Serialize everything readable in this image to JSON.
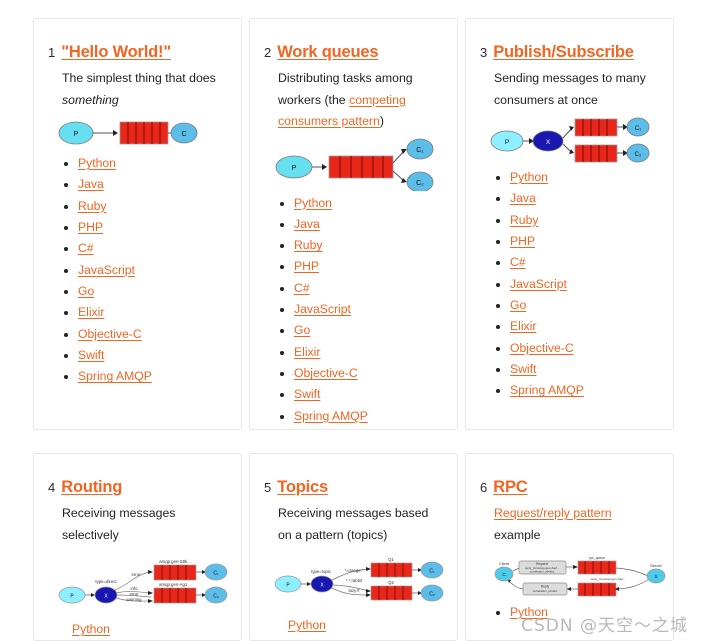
{
  "page": {
    "watermark": "CSDN @天空～之城"
  },
  "languages": [
    "Python",
    "Java",
    "Ruby",
    "PHP",
    "C#",
    "JavaScript",
    "Go",
    "Elixir",
    "Objective-C",
    "Swift",
    "Spring AMQP"
  ],
  "cards": [
    {
      "number": "1",
      "title": "\"Hello World!\"",
      "desc_lead": "The simplest thing that does ",
      "desc_em": "something",
      "desc_tail": "",
      "inline_link": "",
      "diagram": {
        "name": "hello-world-diagram",
        "producer": "P",
        "consumers": [
          "C"
        ],
        "queues": 1,
        "exchange": null
      }
    },
    {
      "number": "2",
      "title": "Work queues",
      "desc_lead": "Distributing tasks among workers (the ",
      "desc_em": "",
      "inline_link": "competing consumers pattern",
      "desc_tail": ")",
      "diagram": {
        "name": "work-queues-diagram",
        "producer": "P",
        "consumers": [
          "C₁",
          "C₂"
        ],
        "queues": 1,
        "exchange": null
      }
    },
    {
      "number": "3",
      "title": "Publish/Subscribe",
      "desc_lead": "Sending messages to many consumers at once",
      "desc_em": "",
      "inline_link": "",
      "desc_tail": "",
      "diagram": {
        "name": "publish-subscribe-diagram",
        "producer": "P",
        "exchange": "X",
        "consumers": [
          "C₁",
          "C₂"
        ],
        "queues": 2
      }
    },
    {
      "number": "4",
      "title": "Routing",
      "desc_lead": "Receiving messages selectively",
      "desc_em": "",
      "inline_link": "",
      "desc_tail": "",
      "tail_link": "Python",
      "diagram": {
        "name": "routing-diagram",
        "producer": "P",
        "exchange": "X",
        "exchange_label": "type=direct",
        "bindings": [
          "error",
          "info",
          "error",
          "warning"
        ],
        "queue_labels": [
          "amqp.gen-S8k...",
          "amqp.gen-Ag1..."
        ],
        "consumers": [
          "C₁",
          "C₂"
        ]
      }
    },
    {
      "number": "5",
      "title": "Topics",
      "desc_lead": "Receiving messages based on a pattern (topics)",
      "desc_em": "",
      "inline_link": "",
      "desc_tail": "",
      "tail_link": "Python",
      "diagram": {
        "name": "topics-diagram",
        "producer": "P",
        "exchange": "X",
        "exchange_label": "type=topic",
        "bindings": [
          "*.orange.*",
          "*.*.rabbit",
          "lazy.#"
        ],
        "queue_labels": [
          "Q1",
          "Q2"
        ],
        "consumers": [
          "C₁",
          "C₂"
        ]
      }
    },
    {
      "number": "6",
      "title": "RPC",
      "desc_lead": "",
      "desc_em": "",
      "inline_link": "Request/reply pattern",
      "desc_tail": " example",
      "tail_bullet": "Python",
      "diagram": {
        "name": "rpc-diagram",
        "client": "Client",
        "server": "Server",
        "request_box": "Request reply_to=amqp.gen-Xa2... correlation_id=abc",
        "reply_box": "Reply correlation_id=abc",
        "queue_labels": [
          "rpc_queue",
          "reply_to=amqp.gen-Xa2..."
        ]
      }
    }
  ],
  "colors": {
    "accent": "#f26522",
    "producer": "#66e0f0",
    "consumer": "#5bbde8",
    "exchange": "#1818b0",
    "queue": "#e8261a",
    "card_border": "#e6e6e6",
    "text": "#1f1f1f",
    "watermark": "#b9b9b9"
  }
}
